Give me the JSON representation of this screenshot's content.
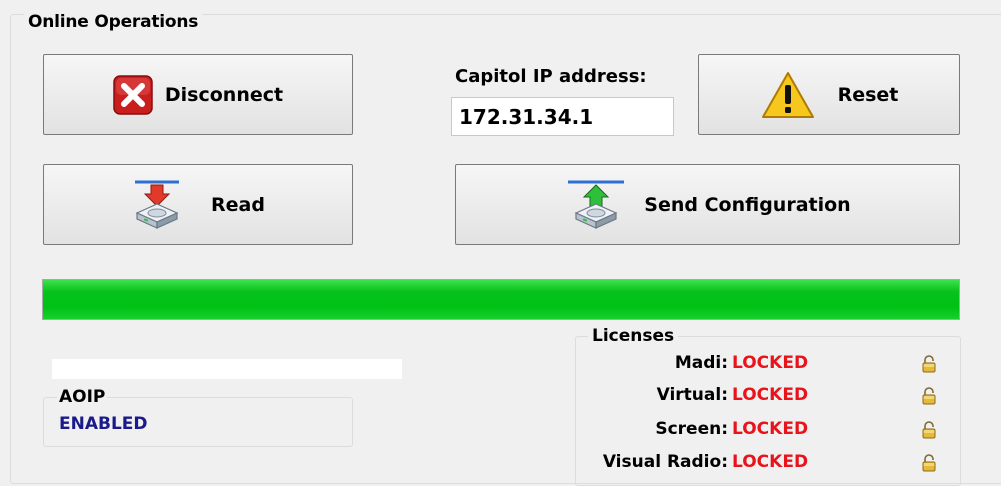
{
  "panel": {
    "title": "Online Operations"
  },
  "buttons": {
    "disconnect": "Disconnect",
    "reset": "Reset",
    "read": "Read",
    "send": "Send Configuration"
  },
  "ip": {
    "label": "Capitol IP address:",
    "value": "172.31.34.1"
  },
  "progress": {
    "percent": 100,
    "color": "#00c116"
  },
  "aoip": {
    "title": "AOIP",
    "status": "ENABLED"
  },
  "licenses": {
    "title": "Licenses",
    "items": [
      {
        "name": "Madi:",
        "status": "LOCKED"
      },
      {
        "name": "Virtual:",
        "status": "LOCKED"
      },
      {
        "name": "Screen:",
        "status": "LOCKED"
      },
      {
        "name": "Visual Radio:",
        "status": "LOCKED"
      }
    ]
  },
  "colors": {
    "locked": "#e8141c",
    "enabled": "#1a1a8a",
    "progress": "#00c116"
  }
}
